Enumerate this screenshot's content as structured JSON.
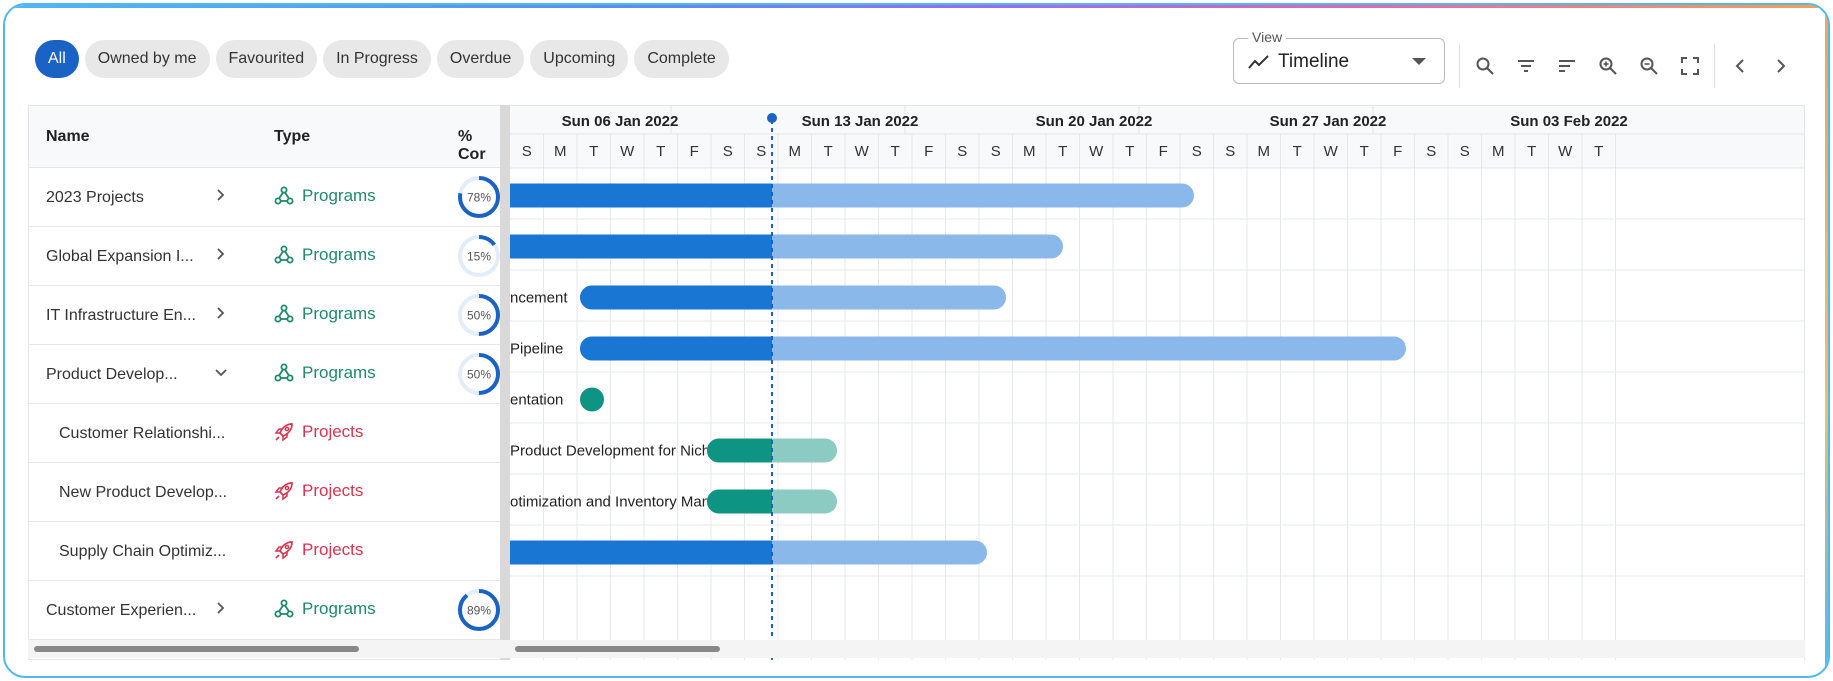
{
  "filters": [
    "All",
    "Owned by me",
    "Favourited",
    "In Progress",
    "Overdue",
    "Upcoming",
    "Complete"
  ],
  "active_filter": "All",
  "view": {
    "label": "View",
    "value": "Timeline"
  },
  "toolbar": {
    "icons": [
      "search-icon",
      "filter-icon",
      "sort-icon",
      "zoom-in-icon",
      "zoom-out-icon",
      "fullscreen-icon",
      "chevron-left-icon",
      "chevron-right-icon"
    ]
  },
  "table": {
    "headers": {
      "name": "Name",
      "type": "Type",
      "pct": "% Cor"
    },
    "rows": [
      {
        "name": "2023 Projects",
        "type": "Programs",
        "pct": "78%",
        "expanded": false,
        "child": false
      },
      {
        "name": "Global Expansion I...",
        "type": "Programs",
        "pct": "15%",
        "expanded": false,
        "child": false
      },
      {
        "name": "IT Infrastructure En...",
        "type": "Programs",
        "pct": "50%",
        "expanded": false,
        "child": false
      },
      {
        "name": "Product Develop...",
        "type": "Programs",
        "pct": "50%",
        "expanded": true,
        "child": false
      },
      {
        "name": "Customer Relationshi...",
        "type": "Projects",
        "pct": "",
        "expanded": false,
        "child": true
      },
      {
        "name": "New Product Develop...",
        "type": "Projects",
        "pct": "",
        "expanded": false,
        "child": true
      },
      {
        "name": "Supply Chain Optimiz...",
        "type": "Projects",
        "pct": "",
        "expanded": false,
        "child": true
      },
      {
        "name": "Customer Experien...",
        "type": "Programs",
        "pct": "89%",
        "expanded": false,
        "child": false
      }
    ]
  },
  "timeline": {
    "weeks": [
      "Sun 06 Jan 2022",
      "Sun 13 Jan 2022",
      "Sun 20 Jan 2022",
      "Sun 27 Jan 2022",
      "Sun 03 Feb 2022"
    ],
    "day_letters": [
      "S",
      "M",
      "T",
      "W",
      "T",
      "F",
      "S",
      "S",
      "M",
      "T",
      "W",
      "T",
      "F",
      "S",
      "S",
      "M",
      "T",
      "W",
      "T",
      "F",
      "S",
      "S",
      "M",
      "T",
      "W",
      "T",
      "F",
      "S",
      "S",
      "M",
      "T",
      "W",
      "T"
    ],
    "bar_labels": [
      "ncement",
      "Pipeline",
      "entation",
      "Product Development for Niche Market",
      "otimization and Inventory Management"
    ]
  },
  "colors": {
    "accent": "#1a63c4",
    "programs": "#1f8a6b",
    "projects": "#d9344e",
    "bar_blue": "#1976d2",
    "bar_blue_light": "#8ab8ea",
    "bar_teal": "#0e9482",
    "bar_teal_light": "#8ccbc2"
  }
}
